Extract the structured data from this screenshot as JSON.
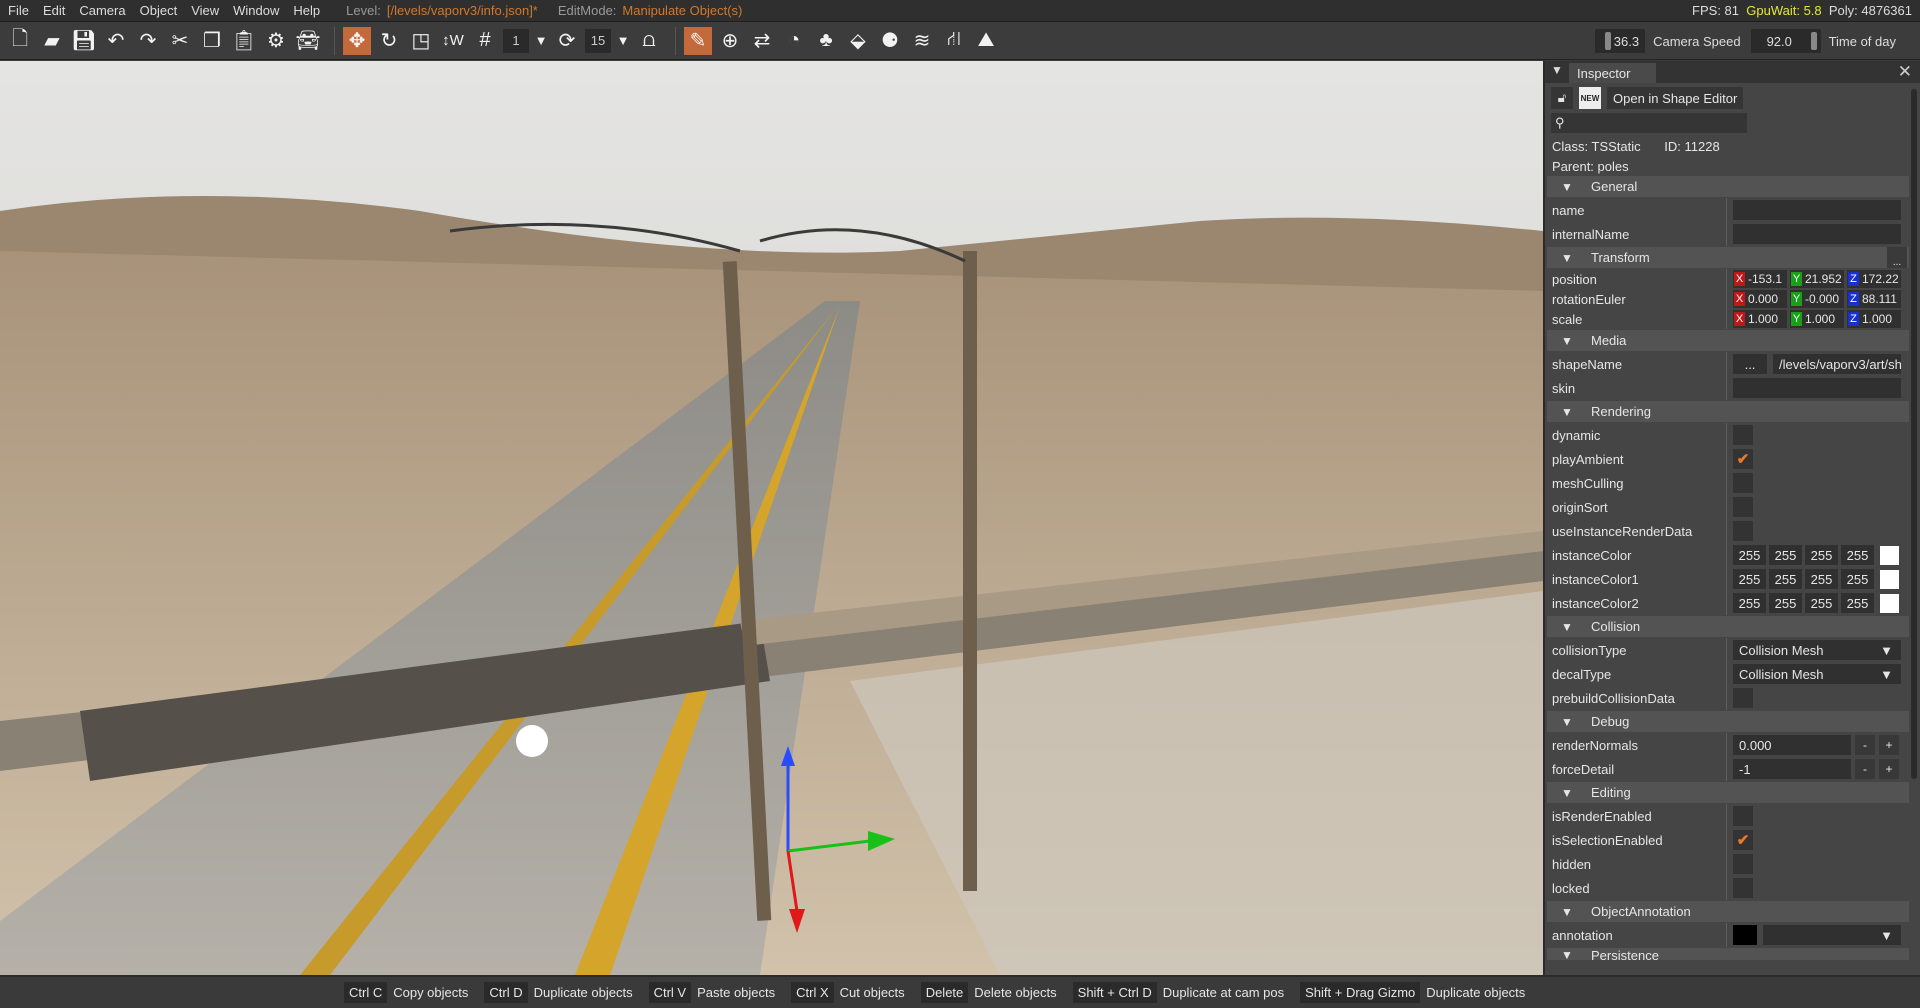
{
  "menu": {
    "items": [
      "File",
      "Edit",
      "Camera",
      "Object",
      "View",
      "Window",
      "Help"
    ],
    "level_label": "Level:",
    "level_value": "[/levels/vaporv3/info.json]*",
    "editmode_label": "EditMode:",
    "editmode_value": "Manipulate Object(s)"
  },
  "stats": {
    "fps": "FPS: 81",
    "gpu": "GpuWait: 5.8",
    "poly": "Poly: 4876361"
  },
  "toolbar": {
    "snap_value": "1",
    "rot_snap_value": "15",
    "camera_speed_value": "36.3",
    "camera_speed_label": "Camera Speed",
    "time_of_day_value": "92.0",
    "time_of_day_label": "Time of day"
  },
  "inspector": {
    "title": "Inspector",
    "new_badge": "NEW",
    "open_shape_editor": "Open in Shape Editor",
    "class_label": "Class:",
    "class_value": "TSStatic",
    "id_label": "ID:",
    "id_value": "11228",
    "parent_label": "Parent:",
    "parent_value": "poles",
    "sections": {
      "general": "General",
      "transform": "Transform",
      "media": "Media",
      "rendering": "Rendering",
      "collision": "Collision",
      "debug": "Debug",
      "editing": "Editing",
      "annotation": "ObjectAnnotation",
      "persistence": "Persistence"
    },
    "fields": {
      "name": "name",
      "internalName": "internalName",
      "position": {
        "label": "position",
        "x": "-153.1",
        "y": "21.952",
        "z": "172.22"
      },
      "rotationEuler": {
        "label": "rotationEuler",
        "x": "0.000",
        "y": "-0.000",
        "z": "88.111"
      },
      "scale": {
        "label": "scale",
        "x": "1.000",
        "y": "1.000",
        "z": "1.000"
      },
      "axis": {
        "x": "X",
        "y": "Y",
        "z": "Z"
      },
      "shapeName": {
        "label": "shapeName",
        "button": "...",
        "value": "/levels/vaporv3/art/sh"
      },
      "skin": "skin",
      "dynamic": {
        "label": "dynamic",
        "checked": false
      },
      "playAmbient": {
        "label": "playAmbient",
        "checked": true
      },
      "meshCulling": {
        "label": "meshCulling",
        "checked": false
      },
      "originSort": {
        "label": "originSort",
        "checked": false
      },
      "useInstanceRenderData": {
        "label": "useInstanceRenderData",
        "checked": false
      },
      "instanceColor": {
        "label": "instanceColor",
        "values": [
          "255",
          "255",
          "255",
          "255"
        ]
      },
      "instanceColor1": {
        "label": "instanceColor1",
        "values": [
          "255",
          "255",
          "255",
          "255"
        ]
      },
      "instanceColor2": {
        "label": "instanceColor2",
        "values": [
          "255",
          "255",
          "255",
          "255"
        ]
      },
      "collisionType": {
        "label": "collisionType",
        "value": "Collision Mesh"
      },
      "decalType": {
        "label": "decalType",
        "value": "Collision Mesh"
      },
      "prebuildCollisionData": {
        "label": "prebuildCollisionData",
        "checked": false
      },
      "renderNormals": {
        "label": "renderNormals",
        "value": "0.000"
      },
      "forceDetail": {
        "label": "forceDetail",
        "value": "-1"
      },
      "stepper": {
        "minus": "-",
        "plus": "+"
      },
      "isRenderEnabled": {
        "label": "isRenderEnabled",
        "checked": false
      },
      "isSelectionEnabled": {
        "label": "isSelectionEnabled",
        "checked": true
      },
      "hidden": {
        "label": "hidden",
        "checked": false
      },
      "locked": {
        "label": "locked",
        "checked": false
      },
      "annotation": {
        "label": "annotation",
        "color": "#000000"
      }
    },
    "check_glyph": "✔"
  },
  "shortcuts": [
    {
      "key": "Ctrl C",
      "action": "Copy objects"
    },
    {
      "key": "Ctrl D",
      "action": "Duplicate objects"
    },
    {
      "key": "Ctrl V",
      "action": "Paste objects"
    },
    {
      "key": "Ctrl X",
      "action": "Cut objects"
    },
    {
      "key": "Delete",
      "action": "Delete objects"
    },
    {
      "key": "Shift + Ctrl D",
      "action": "Duplicate at cam pos"
    },
    {
      "key": "Shift + Drag Gizmo",
      "action": "Duplicate objects"
    }
  ],
  "colors": {
    "accent": "#c4693a",
    "check": "#e87a2a",
    "level": "#d0782f",
    "gpu": "#e6e63a",
    "axis_x": "#c01818",
    "axis_y": "#18a018",
    "axis_z": "#1830d0"
  }
}
